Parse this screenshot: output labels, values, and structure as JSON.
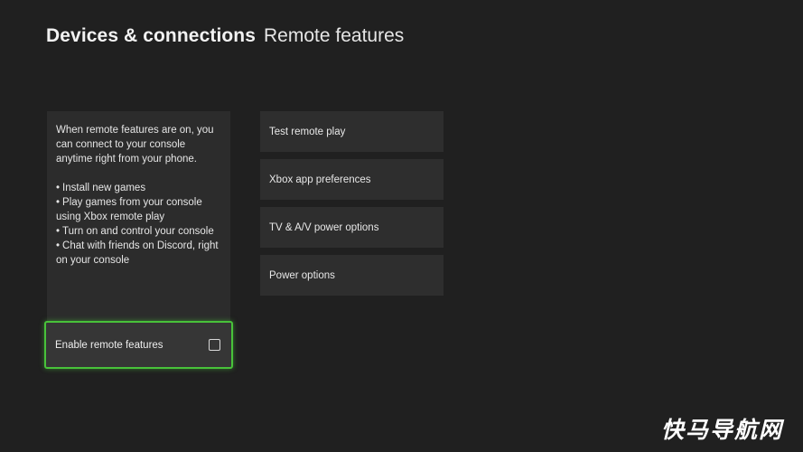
{
  "header": {
    "section": "Devices & connections",
    "page": "Remote features"
  },
  "info_panel": {
    "intro": "When remote features are on, you can connect to your console anytime right from your phone.",
    "bullets": [
      "Install new games",
      "Play games from your console using Xbox remote play",
      "Turn on and control your console",
      "Chat with friends on Discord, right on your console"
    ],
    "bullet_char": "•"
  },
  "enable_remote_features": {
    "label": "Enable remote features",
    "checked": false
  },
  "options": [
    {
      "label": "Test remote play"
    },
    {
      "label": "Xbox app preferences"
    },
    {
      "label": "TV & A/V power options"
    },
    {
      "label": "Power options"
    }
  ],
  "watermark": "快马导航网",
  "colors": {
    "background": "#202020",
    "panel": "#2c2c2c",
    "focus": "#48c23a"
  }
}
